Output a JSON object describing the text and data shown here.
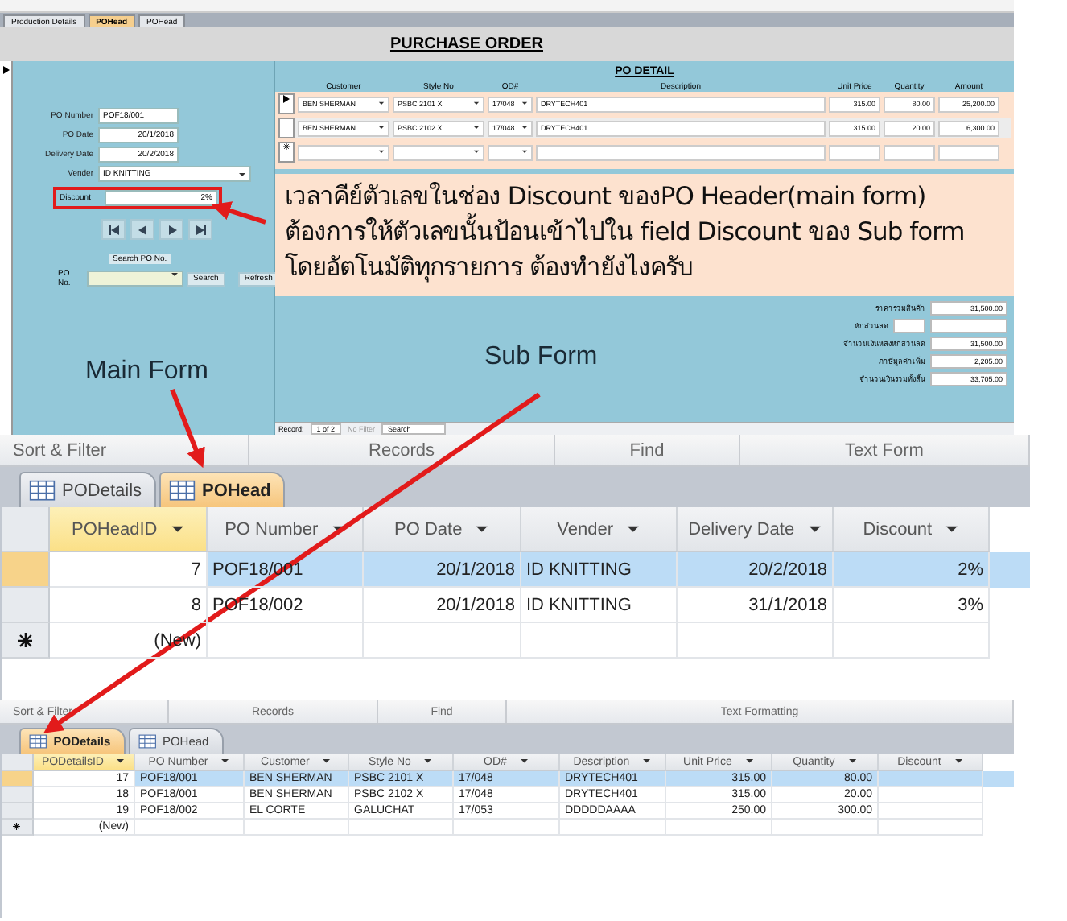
{
  "top_tabs": [
    {
      "label": "Production Details",
      "selected": false
    },
    {
      "label": "POHead",
      "selected": true
    },
    {
      "label": "POHead",
      "selected": false
    }
  ],
  "form": {
    "title": "PURCHASE ORDER",
    "fields": [
      {
        "label": "PO Number",
        "value": "POF18/001",
        "kind": "text",
        "highlighted": false
      },
      {
        "label": "PO Date",
        "value": "20/1/2018",
        "kind": "date",
        "highlighted": false
      },
      {
        "label": "Delivery Date",
        "value": "20/2/2018",
        "kind": "date",
        "highlighted": false
      },
      {
        "label": "Vender",
        "value": "ID KNITTING",
        "kind": "combo",
        "highlighted": false
      },
      {
        "label": "Discount",
        "value": "2%",
        "kind": "date",
        "highlighted": true
      }
    ],
    "search": {
      "caption": "Search PO No.",
      "label": "PO No.",
      "button": "Search",
      "refresh": "Refresh"
    },
    "annotation": "Main Form"
  },
  "detail": {
    "title": "PO DETAIL",
    "columns": [
      "Customer",
      "Style No",
      "OD#",
      "Description",
      "Unit Price",
      "Quantity",
      "Amount"
    ],
    "rows": [
      {
        "current": true,
        "customer": "BEN SHERMAN",
        "style": "PSBC 2101 X",
        "od": "17/048",
        "description": "DRYTECH401",
        "unit_price": "315.00",
        "quantity": "80.00",
        "amount": "25,200.00"
      },
      {
        "current": false,
        "customer": "BEN SHERMAN",
        "style": "PSBC 2102 X",
        "od": "17/048",
        "description": "DRYTECH401",
        "unit_price": "315.00",
        "quantity": "20.00",
        "amount": "6,300.00"
      }
    ],
    "totals": [
      {
        "label": "ราคารวมสินค้า",
        "value": "31,500.00"
      },
      {
        "label": "หักส่วนลด"
      },
      {
        "label": "จำนวนเงินหลังหักส่วนลด",
        "value": "31,500.00"
      },
      {
        "label": "ภาษีมูลค่าเพิ่ม",
        "value": "2,205.00"
      },
      {
        "label": "จำนวนเงินรวมทั้งสิ้น",
        "value": "33,705.00"
      }
    ],
    "record_nav": {
      "label": "Record:",
      "position": "1 of 2",
      "filter": "No Filter",
      "search": "Search"
    },
    "annotation": "Sub Form"
  },
  "callout": [
    "เวลาคีย์ตัวเลขในช่อง Discount ของPO Header(main form)",
    "ต้องการให้ตัวเลขนั้นป้อนเข้าไปใน field Discount ของ Sub form",
    "โดยอัตโนมัติทุกรายการ ต้องทำยังไงครับ"
  ],
  "ribbon_1": [
    "Sort & Filter",
    "Records",
    "Find",
    "Text Form"
  ],
  "tabs_1": [
    {
      "label": "PODetails",
      "selected": false
    },
    {
      "label": "POHead",
      "selected": true
    }
  ],
  "grid_1": {
    "columns": [
      {
        "label": "POHeadID",
        "kind": "number"
      },
      {
        "label": "PO Number",
        "kind": "text"
      },
      {
        "label": "PO Date",
        "kind": "number"
      },
      {
        "label": "Vender",
        "kind": "text"
      },
      {
        "label": "Delivery Date",
        "kind": "number"
      },
      {
        "label": "Discount",
        "kind": "number"
      }
    ],
    "rows": [
      {
        "kind": "record",
        "selected": true,
        "cells": [
          "7",
          "POF18/001",
          "20/1/2018",
          "ID KNITTING",
          "20/2/2018",
          "2%"
        ]
      },
      {
        "kind": "record",
        "selected": false,
        "cells": [
          "8",
          "POF18/002",
          "20/1/2018",
          "ID KNITTING",
          "31/1/2018",
          "3%"
        ]
      },
      {
        "kind": "new",
        "selected": false,
        "cells": [
          "(New)"
        ]
      }
    ]
  },
  "ribbon_2": [
    "Sort & Filter",
    "Records",
    "Find",
    "Text Formatting"
  ],
  "tabs_2": [
    {
      "label": "PODetails",
      "selected": true
    },
    {
      "label": "POHead",
      "selected": false
    }
  ],
  "grid_2": {
    "columns": [
      {
        "label": "PODetailsID",
        "kind": "number"
      },
      {
        "label": "PO Number",
        "kind": "text"
      },
      {
        "label": "Customer",
        "kind": "text"
      },
      {
        "label": "Style No",
        "kind": "text"
      },
      {
        "label": "OD#",
        "kind": "text"
      },
      {
        "label": "Description",
        "kind": "text"
      },
      {
        "label": "Unit Price",
        "kind": "number"
      },
      {
        "label": "Quantity",
        "kind": "number"
      },
      {
        "label": "Discount",
        "kind": "number"
      }
    ],
    "rows": [
      {
        "kind": "record",
        "selected": true,
        "cells": [
          "17",
          "POF18/001",
          "BEN SHERMAN",
          "PSBC 2101 X",
          "17/048",
          "DRYTECH401",
          "315.00",
          "80.00"
        ]
      },
      {
        "kind": "record",
        "selected": false,
        "cells": [
          "18",
          "POF18/001",
          "BEN SHERMAN",
          "PSBC 2102 X",
          "17/048",
          "DRYTECH401",
          "315.00",
          "20.00"
        ]
      },
      {
        "kind": "record",
        "selected": false,
        "cells": [
          "19",
          "POF18/002",
          "EL CORTE",
          "GALUCHAT",
          "17/053",
          "DDDDDAAAA",
          "250.00",
          "300.00"
        ]
      },
      {
        "kind": "new",
        "selected": false,
        "cells": [
          "(New)"
        ]
      }
    ]
  }
}
